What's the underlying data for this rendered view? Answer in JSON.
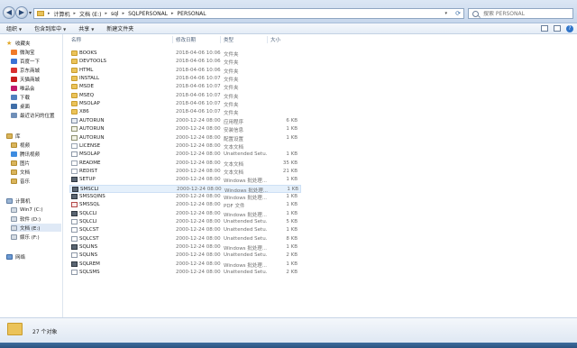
{
  "address": {
    "crumbs": [
      "计算机",
      "文档 (E:)",
      "sql",
      "SQLPERSONAL",
      "PERSONAL"
    ],
    "search_placeholder": "搜索 PERSONAL"
  },
  "commands": {
    "organize": "组织",
    "include": "包含到库中",
    "share": "共享",
    "new_folder": "新建文件夹"
  },
  "sidebar": {
    "favorites_label": "收藏夹",
    "favorites": [
      "微淘宝",
      "百度一下",
      "京东商城",
      "天猫商城",
      "唯品会",
      "下载",
      "桌面",
      "最近访问的位置"
    ],
    "libraries_label": "库",
    "libraries": [
      "视频",
      "腾讯视频",
      "图片",
      "文档",
      "音乐"
    ],
    "computer_label": "计算机",
    "drives": [
      "Win7 (C:)",
      "软件 (D:)",
      "文档 (E:)",
      "娱乐 (F:)"
    ],
    "network_label": "网络"
  },
  "columns": {
    "name": "名称",
    "date": "修改日期",
    "type": "类型",
    "size": "大小"
  },
  "files": [
    {
      "name": "BOOKS",
      "date": "2018-04-06 10:06",
      "type": "文件夹",
      "size": "",
      "icon": "folder"
    },
    {
      "name": "DEVTOOLS",
      "date": "2018-04-06 10:06",
      "type": "文件夹",
      "size": "",
      "icon": "folder"
    },
    {
      "name": "HTML",
      "date": "2018-04-06 10:06",
      "type": "文件夹",
      "size": "",
      "icon": "folder"
    },
    {
      "name": "INSTALL",
      "date": "2018-04-06 10:07",
      "type": "文件夹",
      "size": "",
      "icon": "folder"
    },
    {
      "name": "MSDE",
      "date": "2018-04-06 10:07",
      "type": "文件夹",
      "size": "",
      "icon": "folder"
    },
    {
      "name": "MSEQ",
      "date": "2018-04-06 10:07",
      "type": "文件夹",
      "size": "",
      "icon": "folder"
    },
    {
      "name": "MSOLAP",
      "date": "2018-04-06 10:07",
      "type": "文件夹",
      "size": "",
      "icon": "folder"
    },
    {
      "name": "X86",
      "date": "2018-04-06 10:07",
      "type": "文件夹",
      "size": "",
      "icon": "folder"
    },
    {
      "name": "AUTORUN",
      "date": "2000-12-24 08:00",
      "type": "应用程序",
      "size": "6 KB",
      "icon": "app"
    },
    {
      "name": "AUTORUN",
      "date": "2000-12-24 08:00",
      "type": "安装信息",
      "size": "1 KB",
      "icon": "inf"
    },
    {
      "name": "AUTORUN",
      "date": "2000-12-24 08:00",
      "type": "配置设置",
      "size": "1 KB",
      "icon": "inf"
    },
    {
      "name": "LICENSE",
      "date": "2000-12-24 08:00",
      "type": "文本文档",
      "size": "",
      "icon": "txt"
    },
    {
      "name": "MSOLAP",
      "date": "2000-12-24 08:00",
      "type": "Unattended Setu...",
      "size": "1 KB",
      "icon": "doc"
    },
    {
      "name": "README",
      "date": "2000-12-24 08:00",
      "type": "文本文档",
      "size": "35 KB",
      "icon": "txt"
    },
    {
      "name": "REDIST",
      "date": "2000-12-24 08:00",
      "type": "文本文档",
      "size": "21 KB",
      "icon": "txt"
    },
    {
      "name": "SETUP",
      "date": "2000-12-24 08:00",
      "type": "Windows 批处理...",
      "size": "1 KB",
      "icon": "bat"
    },
    {
      "name": "SMSCLI",
      "date": "2000-12-24 08:00",
      "type": "Windows 批处理...",
      "size": "1 KB",
      "icon": "bat"
    },
    {
      "name": "SMSSQINS",
      "date": "2000-12-24 08:00",
      "type": "Windows 批处理...",
      "size": "1 KB",
      "icon": "bat"
    },
    {
      "name": "SMSSQL",
      "date": "2000-12-24 08:00",
      "type": "PDF 文件",
      "size": "1 KB",
      "icon": "pdf"
    },
    {
      "name": "SQLCLI",
      "date": "2000-12-24 08:00",
      "type": "Windows 批处理...",
      "size": "1 KB",
      "icon": "bat"
    },
    {
      "name": "SQLCLI",
      "date": "2000-12-24 08:00",
      "type": "Unattended Setu...",
      "size": "5 KB",
      "icon": "doc"
    },
    {
      "name": "SQLCST",
      "date": "2000-12-24 08:00",
      "type": "Unattended Setu...",
      "size": "1 KB",
      "icon": "doc"
    },
    {
      "name": "SQLCST",
      "date": "2000-12-24 08:00",
      "type": "Unattended Setu...",
      "size": "8 KB",
      "icon": "doc"
    },
    {
      "name": "SQLINS",
      "date": "2000-12-24 08:00",
      "type": "Windows 批处理...",
      "size": "1 KB",
      "icon": "bat"
    },
    {
      "name": "SQLINS",
      "date": "2000-12-24 08:00",
      "type": "Unattended Setu...",
      "size": "2 KB",
      "icon": "doc"
    },
    {
      "name": "SQLREM",
      "date": "2000-12-24 08:00",
      "type": "Windows 批处理...",
      "size": "1 KB",
      "icon": "bat"
    },
    {
      "name": "SQLSMS",
      "date": "2000-12-24 08:00",
      "type": "Unattended Setu...",
      "size": "2 KB",
      "icon": "doc"
    }
  ],
  "status": {
    "count": "27 个对象"
  }
}
